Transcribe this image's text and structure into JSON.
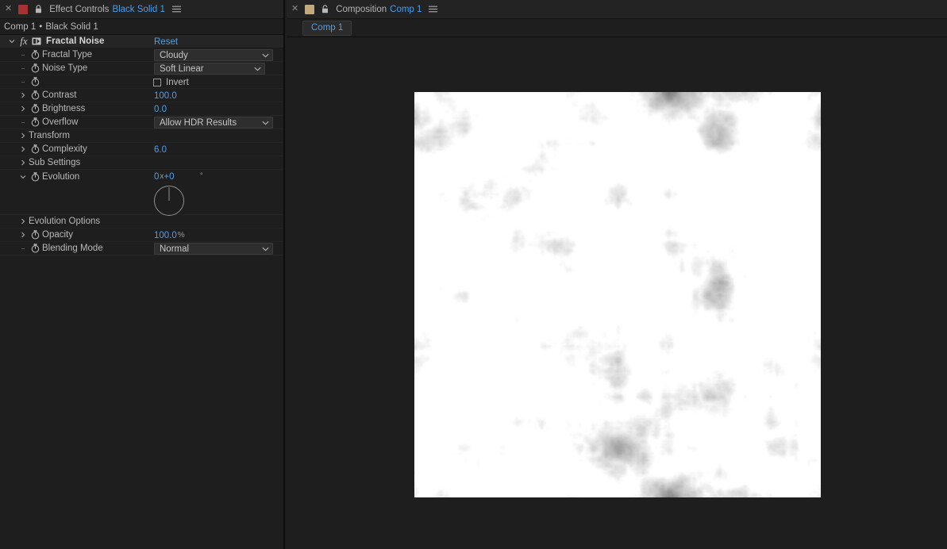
{
  "effect_panel": {
    "tab": {
      "close_icon": "close-icon",
      "swatch_color": "#a83232",
      "lock_icon": "lock-icon",
      "title": "Effect Controls",
      "subject": "Black Solid 1",
      "menu_icon": "hamburger-menu-icon"
    },
    "breadcrumb": {
      "comp": "Comp 1",
      "separator": "•",
      "layer": "Black Solid 1"
    },
    "effect": {
      "name": "Fractal Noise",
      "reset_label": "Reset",
      "fx_glyph": "fx",
      "expanded": true
    },
    "properties": [
      {
        "name": "Fractal Type",
        "type": "dropdown",
        "value": "Cloudy",
        "dropdown_width": 150,
        "has_twirl": false,
        "has_stopwatch": true
      },
      {
        "name": "Noise Type",
        "type": "dropdown",
        "value": "Soft Linear",
        "dropdown_width": 140,
        "has_twirl": false,
        "has_stopwatch": true
      },
      {
        "name": "",
        "type": "checkbox",
        "value": "Invert",
        "checked": false,
        "has_twirl": false,
        "has_stopwatch": true
      },
      {
        "name": "Contrast",
        "type": "number",
        "value": "100.0",
        "unit": "",
        "has_twirl": true,
        "has_stopwatch": true
      },
      {
        "name": "Brightness",
        "type": "number",
        "value": "0.0",
        "unit": "",
        "has_twirl": true,
        "has_stopwatch": true
      },
      {
        "name": "Overflow",
        "type": "dropdown",
        "value": "Allow HDR Results",
        "dropdown_width": 150,
        "has_twirl": false,
        "has_stopwatch": true
      },
      {
        "name": "Transform",
        "type": "group",
        "value": "",
        "has_twirl": true,
        "has_stopwatch": false
      },
      {
        "name": "Complexity",
        "type": "number",
        "value": "6.0",
        "unit": "",
        "has_twirl": true,
        "has_stopwatch": true
      },
      {
        "name": "Sub Settings",
        "type": "group",
        "value": "",
        "has_twirl": true,
        "has_stopwatch": false
      },
      {
        "name": "Evolution",
        "type": "angle",
        "value_revolutions": "0",
        "value_x": "x",
        "value_degrees": "+0",
        "degree_symbol": "°",
        "dial_angle": 0,
        "has_twirl": true,
        "has_stopwatch": true,
        "expanded": true
      },
      {
        "name": "Evolution Options",
        "type": "group",
        "value": "",
        "has_twirl": true,
        "has_stopwatch": false
      },
      {
        "name": "Opacity",
        "type": "number",
        "value": "100.0",
        "unit": "%",
        "has_twirl": true,
        "has_stopwatch": true
      },
      {
        "name": "Blending Mode",
        "type": "dropdown",
        "value": "Normal",
        "dropdown_width": 150,
        "has_twirl": false,
        "has_stopwatch": true
      }
    ]
  },
  "comp_panel": {
    "tab": {
      "close_icon": "close-icon",
      "swatch_color": "#c3a97e",
      "lock_icon": "lock-icon",
      "title": "Composition",
      "subject": "Comp 1",
      "menu_icon": "hamburger-menu-icon"
    },
    "breadcrumb_chip": "Comp 1",
    "viewer": {
      "content": "fractal-noise-render"
    }
  },
  "colors": {
    "accent_blue": "#4e9ee8",
    "panel_bg": "#1e1e1e",
    "tabbar_bg": "#232323",
    "text": "#b9b9b9"
  }
}
